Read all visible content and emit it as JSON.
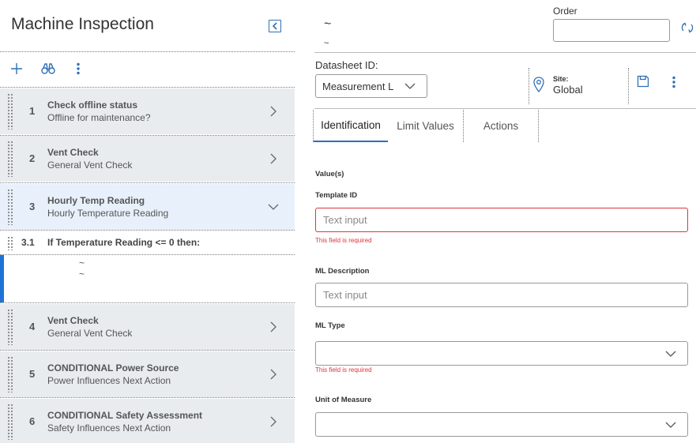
{
  "left_panel": {
    "title": "Machine Inspection",
    "steps": [
      {
        "num": "1",
        "title": "Check offline status",
        "subtitle": "Offline for maintenance?"
      },
      {
        "num": "2",
        "title": "Vent Check",
        "subtitle": "General Vent Check"
      },
      {
        "num": "3",
        "title": "Hourly Temp Reading",
        "subtitle": "Hourly Temperature Reading"
      },
      {
        "num": "4",
        "title": "Vent Check",
        "subtitle": "General Vent Check"
      },
      {
        "num": "5",
        "title": "CONDITIONAL Power Source",
        "subtitle": "Power Influences Next Action"
      },
      {
        "num": "6",
        "title": "CONDITIONAL Safety Assessment",
        "subtitle": "Safety Influences Next Action"
      }
    ],
    "substep": {
      "num": "3.1",
      "title": "If Temperature Reading <= 0 then:"
    },
    "condition_lines": [
      "~",
      "~"
    ]
  },
  "right_panel": {
    "header_tilde_1": "~",
    "header_tilde_2": "~",
    "order_label": "Order",
    "order_value": "",
    "datasheet_label": "Datasheet ID:",
    "datasheet_value": "Measurement Location",
    "site_label": "Site:",
    "site_value": "Global",
    "tabs": [
      "Identification",
      "Limit Values",
      "Actions"
    ],
    "values_heading": "Value(s)",
    "fields": {
      "template_id": {
        "label": "Template ID",
        "placeholder": "Text input",
        "error": "This field is required"
      },
      "ml_description": {
        "label": "ML Description",
        "placeholder": "Text input"
      },
      "ml_type": {
        "label": "ML Type",
        "value": "",
        "error": "This field is required"
      },
      "unit_of_measure": {
        "label": "Unit of Measure",
        "value": ""
      }
    }
  },
  "colors": {
    "accent": "#2f6fb5",
    "error": "#d9363e",
    "step_bg": "#e9ecef",
    "step_active_bg": "#e8f1fb",
    "condition_bar": "#1e73d6"
  }
}
